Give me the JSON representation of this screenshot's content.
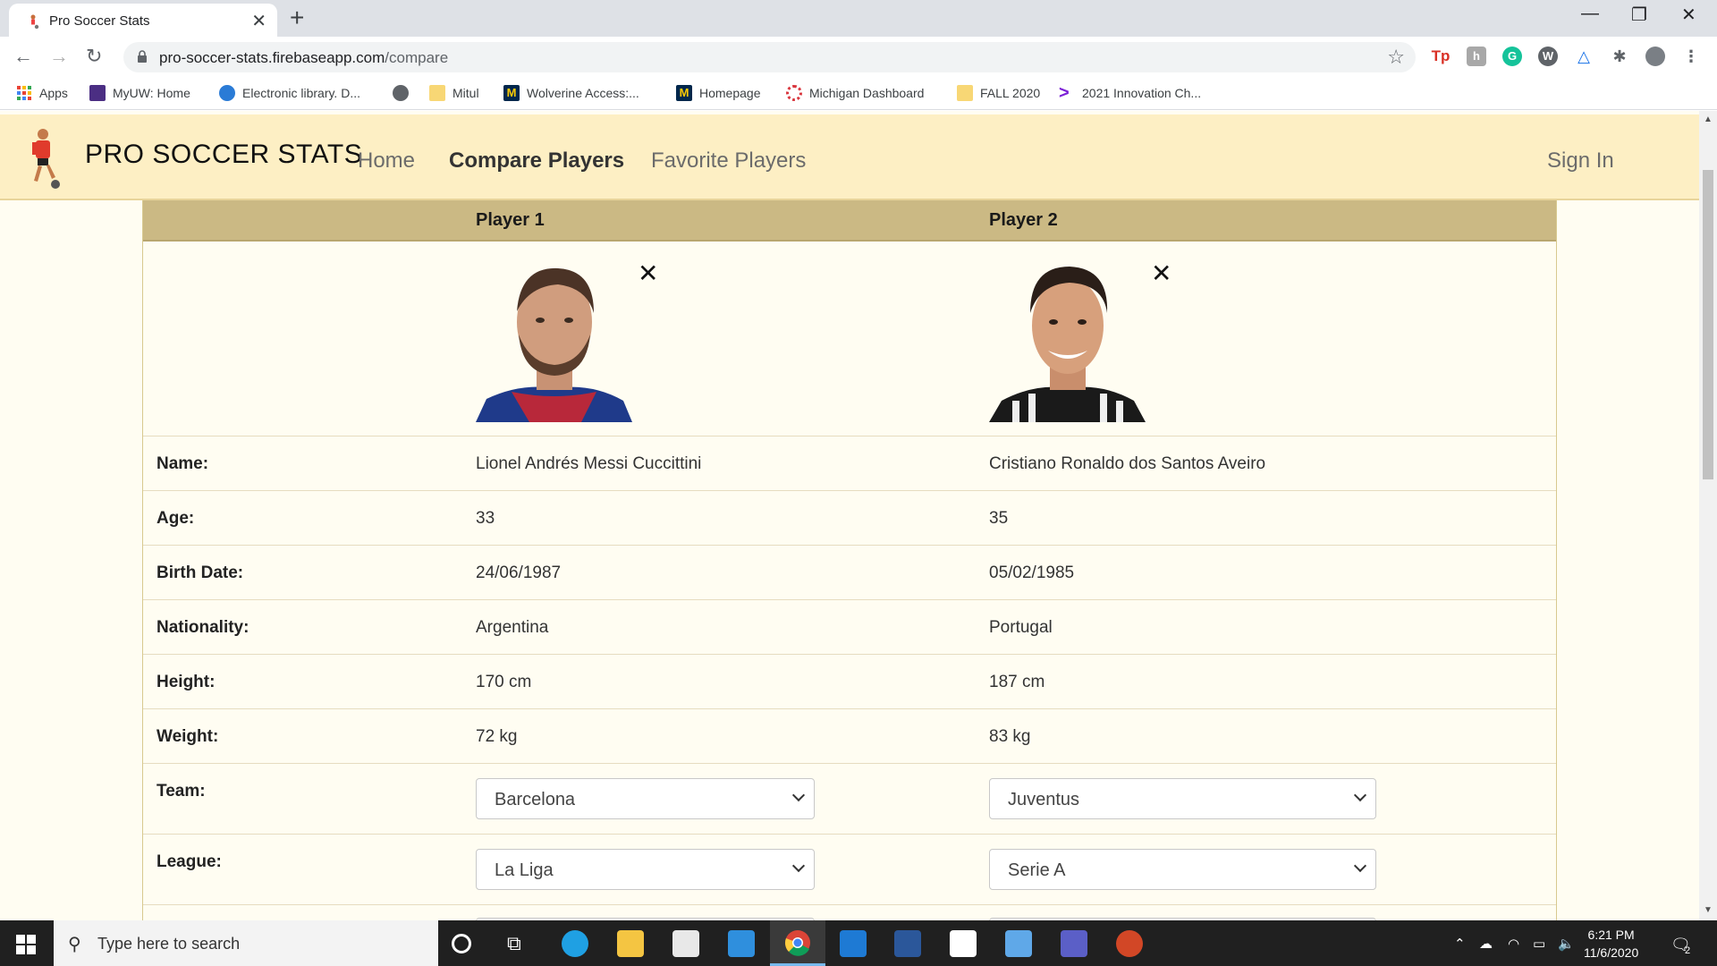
{
  "browser": {
    "tab_title": "Pro Soccer Stats",
    "url_host": "pro-soccer-stats.firebaseapp.com",
    "url_path": "/compare",
    "bookmarks": [
      "Apps",
      "MyUW: Home",
      "Electronic library. D...",
      "",
      "Mitul",
      "Wolverine Access:...",
      "Homepage",
      "Michigan Dashboard",
      "FALL 2020",
      "2021 Innovation Ch..."
    ]
  },
  "site": {
    "brand": "PRO SOCCER STATS",
    "nav": {
      "home": "Home",
      "compare": "Compare Players",
      "favorites": "Favorite Players",
      "signin": "Sign In"
    }
  },
  "compare": {
    "headers": {
      "p1": "Player 1",
      "p2": "Player 2"
    },
    "remove_symbol": "✕",
    "rows": [
      {
        "label": "Name:",
        "p1": "Lionel Andrés Messi Cuccittini",
        "p2": "Cristiano Ronaldo dos Santos Aveiro"
      },
      {
        "label": "Age:",
        "p1": "33",
        "p2": "35"
      },
      {
        "label": "Birth Date:",
        "p1": "24/06/1987",
        "p2": "05/02/1985"
      },
      {
        "label": "Nationality:",
        "p1": "Argentina",
        "p2": "Portugal"
      },
      {
        "label": "Height:",
        "p1": "170 cm",
        "p2": "187 cm"
      },
      {
        "label": "Weight:",
        "p1": "72 kg",
        "p2": "83 kg"
      }
    ],
    "selects": [
      {
        "label": "Team:",
        "p1": "Barcelona",
        "p2": "Juventus"
      },
      {
        "label": "League:",
        "p1": "La Liga",
        "p2": "Serie A"
      }
    ]
  },
  "taskbar": {
    "search_placeholder": "Type here to search",
    "time": "6:21 PM",
    "date": "11/6/2020",
    "notification_count": "2"
  },
  "colors": {
    "site_nav_bg": "#fdefc4",
    "table_header_bg": "#cbb984",
    "page_bg": "#fffdf2"
  }
}
